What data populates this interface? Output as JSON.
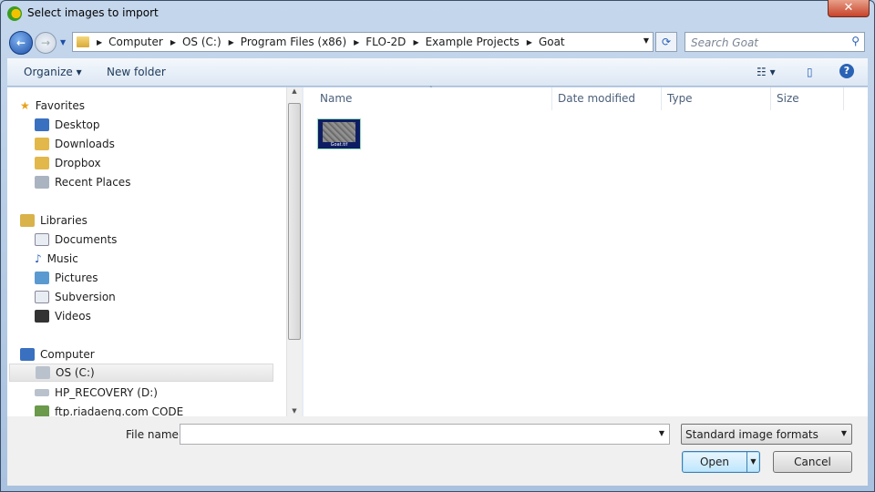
{
  "window": {
    "title": "Select images to import",
    "close": "✕"
  },
  "address": {
    "crumbs": [
      "Computer",
      "OS (C:)",
      "Program Files (x86)",
      "FLO-2D",
      "Example Projects",
      "Goat"
    ],
    "search_placeholder": "Search Goat"
  },
  "toolbar": {
    "organize": "Organize ▾",
    "new_folder": "New folder",
    "views": "☷ ▾",
    "preview": "▯",
    "help": "?"
  },
  "sidebar": {
    "favorites_label": "Favorites",
    "favorites": [
      "Desktop",
      "Downloads",
      "Dropbox",
      "Recent Places"
    ],
    "libraries_label": "Libraries",
    "libraries": [
      "Documents",
      "Music",
      "Pictures",
      "Subversion",
      "Videos"
    ],
    "computer_label": "Computer",
    "drives": [
      "OS (C:)",
      "HP_RECOVERY (D:)",
      "ftp.riadaeng.com  CODE"
    ]
  },
  "columns": [
    "Name",
    "Date modified",
    "Type",
    "Size"
  ],
  "files": [
    {
      "name": "Goat.tif"
    }
  ],
  "bottom": {
    "file_name_label": "File name:",
    "file_name_value": "",
    "file_type": "Standard image formats",
    "open": "Open",
    "cancel": "Cancel"
  }
}
